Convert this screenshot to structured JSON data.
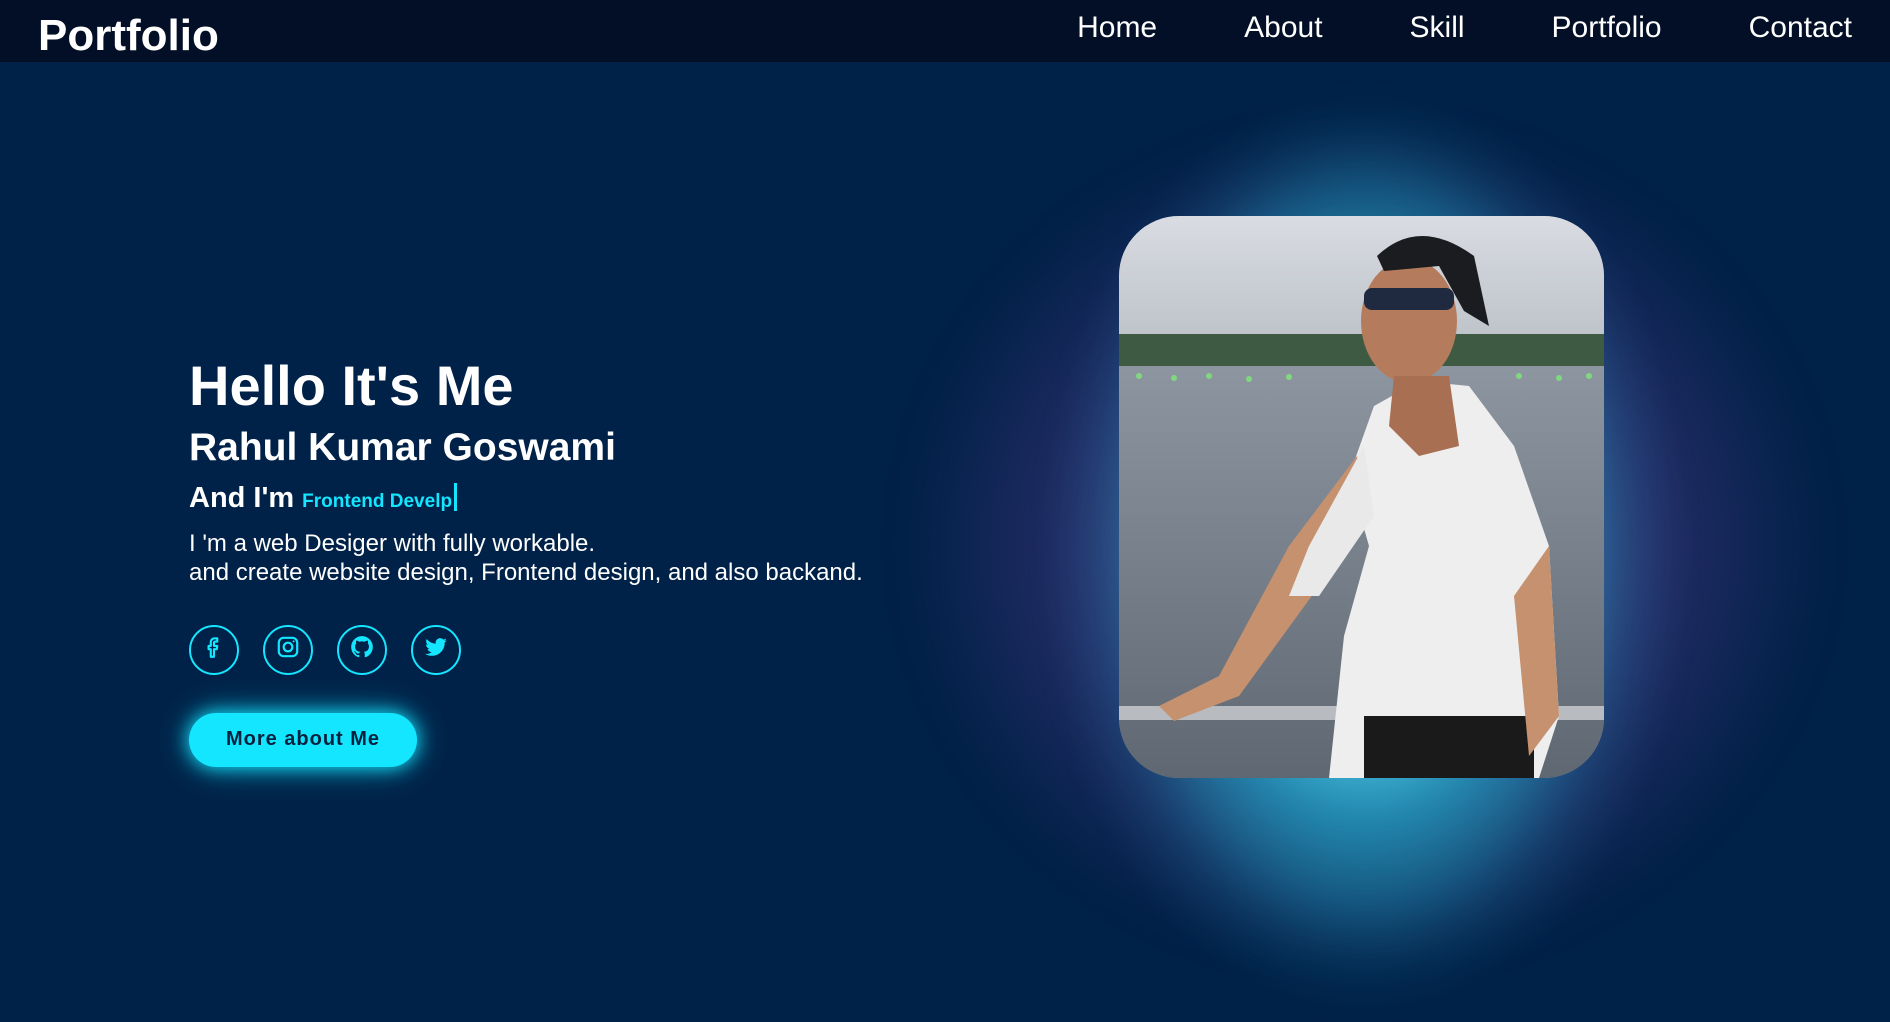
{
  "header": {
    "logo": "Portfolio",
    "nav": [
      {
        "label": "Home"
      },
      {
        "label": "About"
      },
      {
        "label": "Skill"
      },
      {
        "label": "Portfolio"
      },
      {
        "label": "Contact"
      }
    ]
  },
  "hero": {
    "greeting": "Hello It's Me",
    "name": "Rahul Kumar Goswami",
    "role_prefix": "And I'm",
    "role_typed": "Frontend Develp",
    "description_line1": "I 'm a web Desiger with fully workable.",
    "description_line2": "and create website design, Frontend design, and also backand.",
    "socials": [
      {
        "icon": "facebook-icon"
      },
      {
        "icon": "instagram-icon"
      },
      {
        "icon": "github-icon"
      },
      {
        "icon": "twitter-icon"
      }
    ],
    "cta_label": "More about Me"
  },
  "colors": {
    "background": "#002148",
    "header": "#020f26",
    "accent": "#14e6ff"
  }
}
